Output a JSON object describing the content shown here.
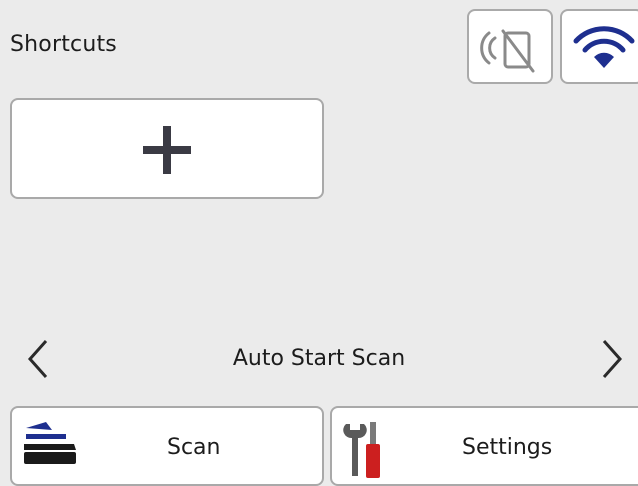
{
  "header": {
    "title": "Shortcuts"
  },
  "status_icons": {
    "nfc": "nfc-disabled-icon",
    "wifi": "wifi-icon"
  },
  "shortcuts": {
    "add_icon": "plus-icon"
  },
  "navigator": {
    "current_mode": "Auto Start Scan",
    "prev_icon": "chevron-left-icon",
    "next_icon": "chevron-right-icon"
  },
  "tabs": [
    {
      "label": "Scan",
      "icon": "scanner-icon"
    },
    {
      "label": "Settings",
      "icon": "tools-icon"
    }
  ],
  "colors": {
    "background": "#ebebeb",
    "button_bg": "#ffffff",
    "accent_blue": "#1e2f8f",
    "tool_red": "#cc1f1f",
    "icon_dark": "#3a3a44"
  }
}
